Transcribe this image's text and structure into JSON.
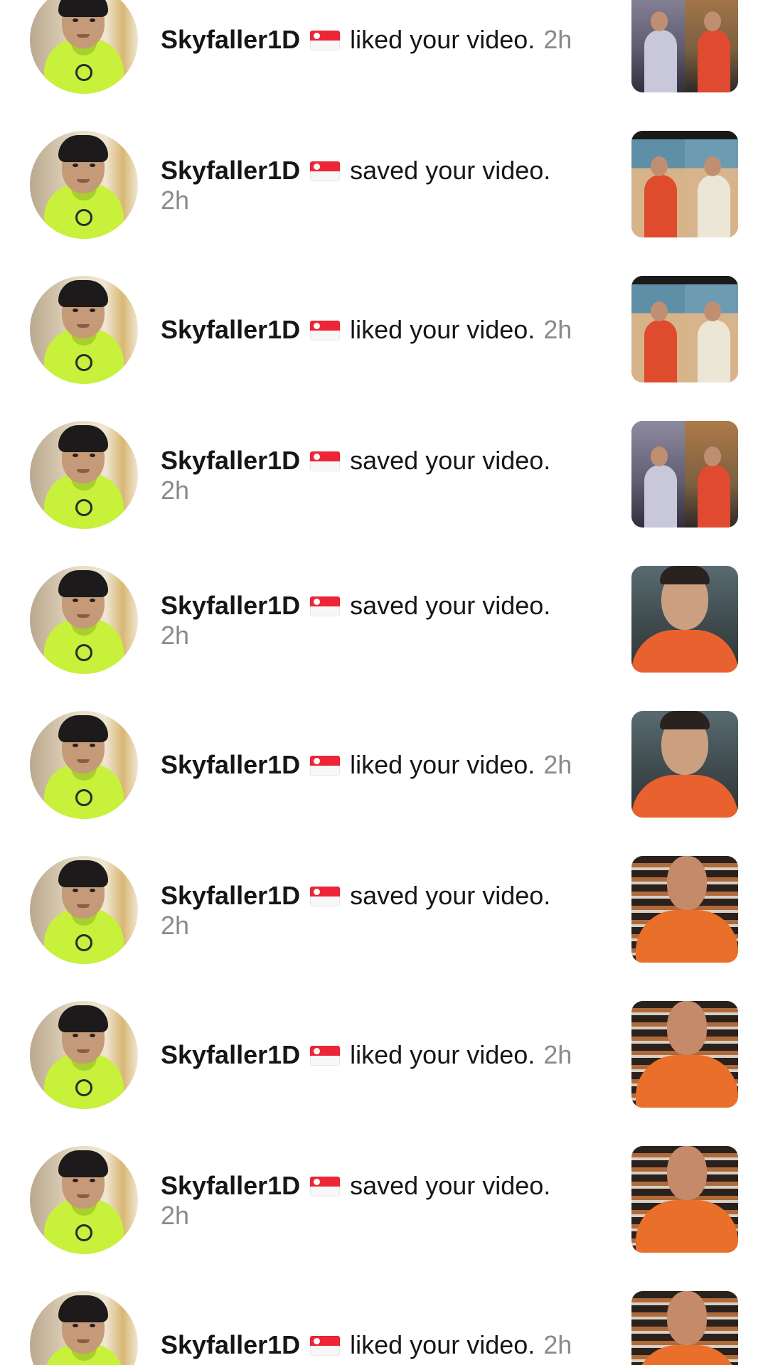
{
  "activity": [
    {
      "user": "Skyfaller1D",
      "action": "liked your video.",
      "time": "2h",
      "thumb_icon": "duet-video-thumbnail"
    },
    {
      "user": "Skyfaller1D",
      "action": "saved your video.",
      "time": "2h",
      "thumb_icon": "duet-video-thumbnail"
    },
    {
      "user": "Skyfaller1D",
      "action": "liked your video.",
      "time": "2h",
      "thumb_icon": "duet-video-thumbnail"
    },
    {
      "user": "Skyfaller1D",
      "action": "saved your video.",
      "time": "2h",
      "thumb_icon": "duet-video-thumbnail"
    },
    {
      "user": "Skyfaller1D",
      "action": "saved your video.",
      "time": "2h",
      "thumb_icon": "face-video-thumbnail"
    },
    {
      "user": "Skyfaller1D",
      "action": "liked your video.",
      "time": "2h",
      "thumb_icon": "face-video-thumbnail"
    },
    {
      "user": "Skyfaller1D",
      "action": "saved your video.",
      "time": "2h",
      "thumb_icon": "shirt-video-thumbnail"
    },
    {
      "user": "Skyfaller1D",
      "action": "liked your video.",
      "time": "2h",
      "thumb_icon": "shirt-video-thumbnail"
    },
    {
      "user": "Skyfaller1D",
      "action": "saved your video.",
      "time": "2h",
      "thumb_icon": "shirt-video-thumbnail"
    },
    {
      "user": "Skyfaller1D",
      "action": "liked your video.",
      "time": "2h",
      "thumb_icon": "shirt-video-thumbnail"
    }
  ],
  "flag_icon": "singapore-flag-icon",
  "colors": {
    "text": "#161616",
    "time": "#8a8a8a",
    "flag_red": "#ee2536",
    "avatar_hoodie": "#c7f13a"
  }
}
